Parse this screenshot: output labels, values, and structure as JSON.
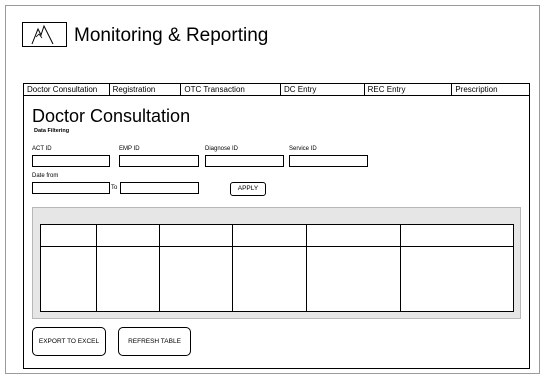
{
  "header": {
    "logo": "mountain-logo",
    "title": "Monitoring & Reporting"
  },
  "tabs": [
    {
      "label": "Doctor Consultation"
    },
    {
      "label": "Registration"
    },
    {
      "label": "OTC Transaction"
    },
    {
      "label": "DC Entry"
    },
    {
      "label": "REC Entry"
    },
    {
      "label": "Prescription"
    }
  ],
  "page": {
    "title": "Doctor Consultation",
    "section_title": "Data Filtering"
  },
  "filters": {
    "act_id_label": "ACT ID",
    "act_id_value": "",
    "emp_id_label": "EMP ID",
    "emp_id_value": "",
    "diagnose_id_label": "Diagnose ID",
    "diagnose_id_value": "",
    "service_id_label": "Service ID",
    "service_id_value": "",
    "date_from_label": "Date from",
    "date_from_value": "",
    "to_label": "To",
    "date_to_value": "",
    "apply_label": "APPLY"
  },
  "table": {
    "columns": [
      "",
      "",
      "",
      "",
      "",
      "",
      ""
    ],
    "rows": [
      [
        "",
        "",
        "",
        "",
        "",
        "",
        ""
      ]
    ]
  },
  "actions": {
    "export_label": "EXPORT TO EXCEL",
    "refresh_label": "REFRESH TABLE"
  }
}
